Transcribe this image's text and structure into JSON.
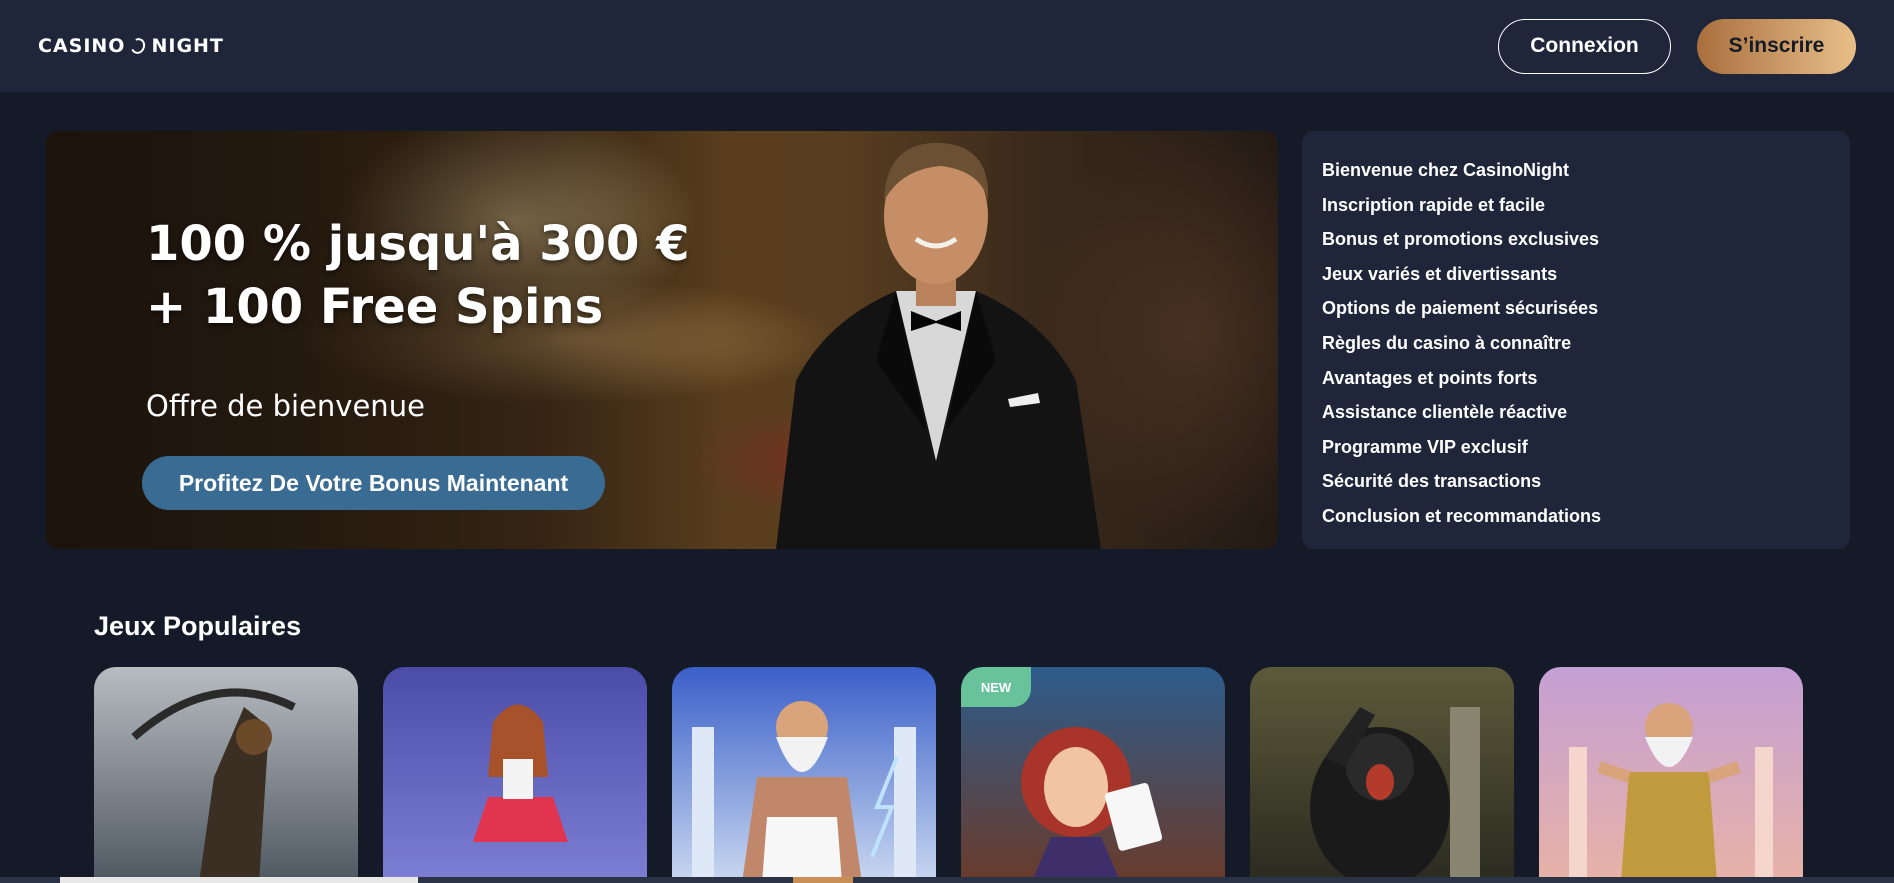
{
  "header": {
    "logo_left": "CASINO",
    "logo_right": "NIGHT",
    "login_label": "Connexion",
    "signup_label": "S’inscrire"
  },
  "hero": {
    "title": "100 % jusqu'à 300 € + 100 Free Spins",
    "subtitle": "Offre de bienvenue",
    "cta_label": "Profitez De Votre Bonus Maintenant"
  },
  "toc": {
    "items": [
      "Bienvenue chez CasinoNight",
      "Inscription rapide et facile",
      "Bonus et promotions exclusives",
      "Jeux variés et divertissants",
      "Options de paiement sécurisées",
      "Règles du casino à connaître",
      "Avantages et points forts",
      "Assistance clientèle réactive",
      "Programme VIP exclusif",
      "Sécurité des transactions",
      "Conclusion et recommandations"
    ]
  },
  "popular": {
    "title": "Jeux Populaires",
    "new_badge": "NEW",
    "games": [
      {
        "art": "warrior-with-scythe",
        "color_top": "#b7bcc1",
        "color_bottom": "#4f5861"
      },
      {
        "art": "anime-girl-dancer",
        "color_top": "#4b4ca8",
        "color_bottom": "#7d7fd4"
      },
      {
        "art": "zeus-lightning",
        "color_top": "#3a5fc8",
        "color_bottom": "#c9d8f0"
      },
      {
        "art": "redhead-poker-card",
        "color_top": "#2d5c8c",
        "color_bottom": "#6a3b2a"
      },
      {
        "art": "gorilla",
        "color_top": "#5d5a3a",
        "color_bottom": "#2a2a20"
      },
      {
        "art": "zeus-temple",
        "color_top": "#c49fd4",
        "color_bottom": "#e8b2a6"
      }
    ]
  },
  "colors": {
    "background": "#141a27",
    "header_bg": "#1f263a",
    "cta_blue": "#3a6c93",
    "signup_gold": "#d3a06b"
  }
}
